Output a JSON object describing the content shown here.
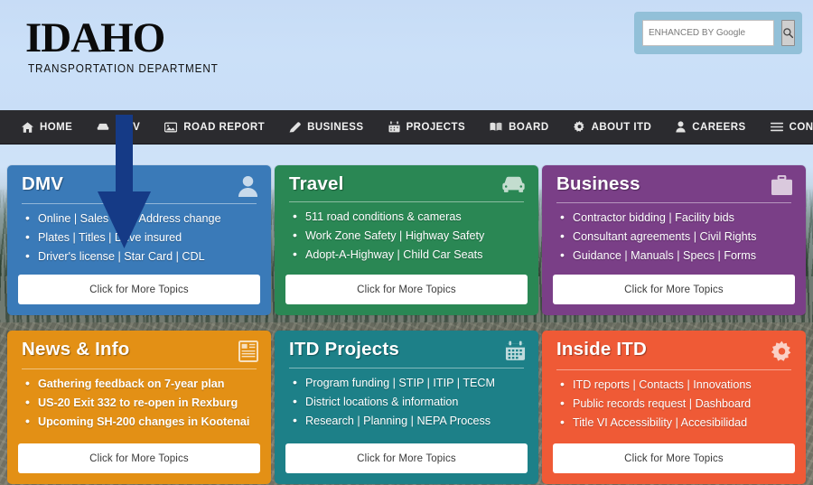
{
  "site": {
    "logo_main": "IDAHO",
    "logo_sub": "TRANSPORTATION DEPARTMENT"
  },
  "search": {
    "placeholder": "ENHANCED BY Google",
    "value": "",
    "button_icon": "search-icon"
  },
  "nav": {
    "items": [
      {
        "label": "HOME",
        "icon": "home-icon"
      },
      {
        "label": "DMV",
        "icon": "car-icon"
      },
      {
        "label": "ROAD REPORT",
        "icon": "image-icon"
      },
      {
        "label": "BUSINESS",
        "icon": "pencil-icon"
      },
      {
        "label": "PROJECTS",
        "icon": "calendar-icon"
      },
      {
        "label": "BOARD",
        "icon": "book-icon"
      },
      {
        "label": "ABOUT ITD",
        "icon": "gear-icon"
      },
      {
        "label": "CAREERS",
        "icon": "person-icon"
      },
      {
        "label": "CONTACT US",
        "icon": "list-icon"
      }
    ]
  },
  "cards": [
    {
      "title": "DMV",
      "icon": "person-icon",
      "color": "#3a7ab8",
      "items": [
        "Online  |  Sales info  |  Address change",
        "Plates  |  Titles  |  Drive insured",
        "Driver's license  |  Star Card  |  CDL"
      ],
      "button": "Click for More Topics"
    },
    {
      "title": "Travel",
      "icon": "car-icon",
      "color": "#2a8754",
      "items": [
        "511 road conditions & cameras",
        "Work Zone Safety  |  Highway Safety",
        "Adopt-A-Highway  |  Child Car Seats"
      ],
      "button": "Click for More Topics"
    },
    {
      "title": "Business",
      "icon": "briefcase-icon",
      "color": "#7a3f87",
      "items": [
        "Contractor bidding  |  Facility bids",
        "Consultant agreements  |  Civil Rights",
        "Guidance  |  Manuals  |  Specs  |  Forms"
      ],
      "button": "Click for More Topics"
    },
    {
      "title": "News & Info",
      "icon": "newspaper-icon",
      "color": "#e39015",
      "items": [
        "Gathering feedback on 7-year plan",
        "US-20 Exit 332 to re-open in Rexburg",
        "Upcoming SH-200 changes in Kootenai"
      ],
      "button": "Click for More Topics"
    },
    {
      "title": "ITD Projects",
      "icon": "calendar-icon",
      "color": "#1d8088",
      "items": [
        "Program funding  |  STIP  |  ITIP  |  TECM",
        "District locations & information",
        "Research  |  Planning  |  NEPA Process"
      ],
      "button": "Click for More Topics"
    },
    {
      "title": "Inside ITD",
      "icon": "gear-icon",
      "color": "#ef5a36",
      "items": [
        "ITD reports  |  Contacts  |  Innovations",
        "Public records request  |  Dashboard",
        "Title VI Accessibility  |  Accesibilidad"
      ],
      "button": "Click for More Topics"
    }
  ],
  "annotation": {
    "arrow_color": "#153a86",
    "arrow_label": "down-arrow pointing at DMV card"
  }
}
